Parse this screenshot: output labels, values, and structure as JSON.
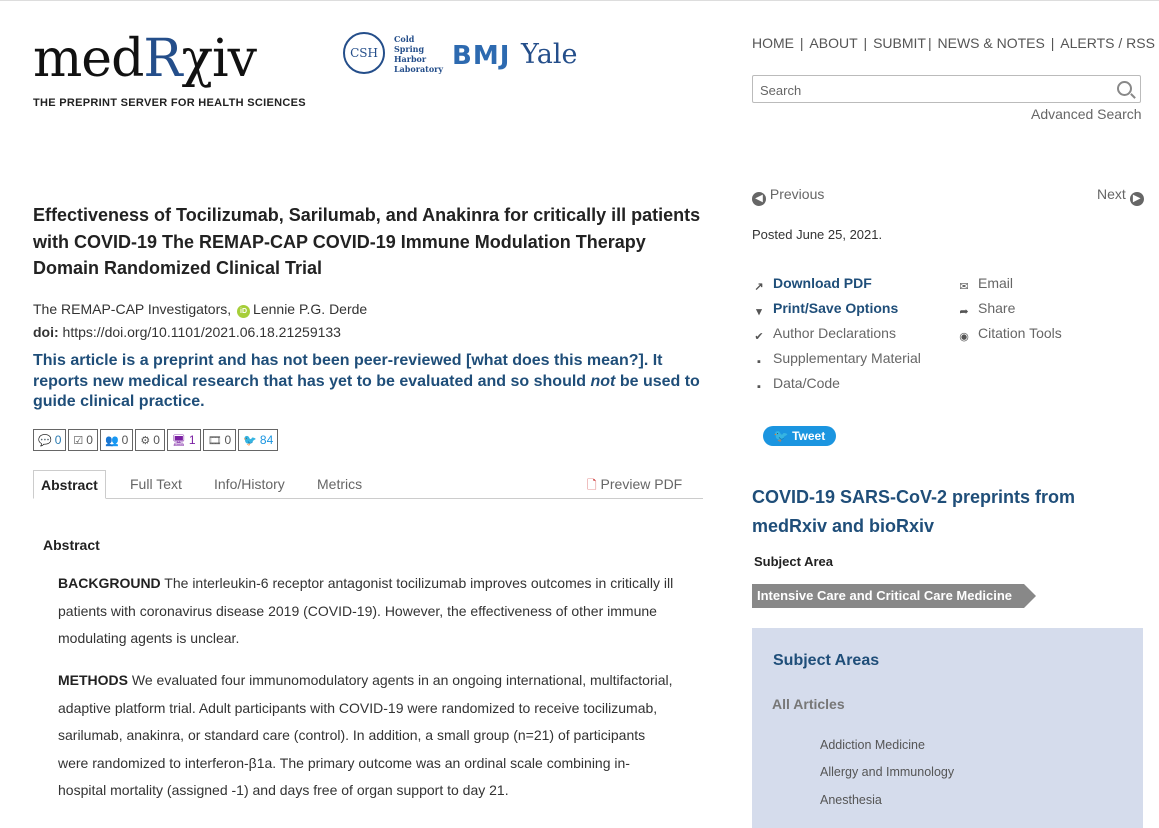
{
  "header": {
    "logo_prefix": "med",
    "logo_r": "R",
    "logo_suffix": "χiv",
    "tagline": "THE PREPRINT SERVER FOR HEALTH SCIENCES",
    "partner_csh_badge": "CSH",
    "partner_csh_text": [
      "Cold",
      "Spring",
      "Harbor",
      "Laboratory"
    ],
    "partner_bmj": "BMJ",
    "partner_yale": "Yale",
    "nav": [
      "HOME",
      "ABOUT",
      "SUBMIT",
      "NEWS & NOTES",
      "ALERTS / RSS"
    ],
    "search_placeholder": "Search",
    "advanced_search": "Advanced Search"
  },
  "article": {
    "title": "Effectiveness of Tocilizumab, Sarilumab, and Anakinra for critically ill patients with COVID-19 The REMAP-CAP COVID-19 Immune Modulation Therapy Domain Randomized Clinical Trial",
    "author_group": "The REMAP-CAP Investigators,",
    "orcid_badge": "iD",
    "author": "Lennie P.G. Derde",
    "doi_label": "doi:",
    "doi_value": "https://doi.org/10.1101/2021.06.18.21259133",
    "notice_part1": "This article is a preprint and has not been peer-reviewed [what does this mean?]. It reports new medical research that has yet to be evaluated and so should ",
    "notice_not": "not",
    "notice_part2": " be used to guide clinical practice.",
    "metrics": [
      {
        "icon": "comment-icon",
        "glyph": "💬",
        "count": "0",
        "color": "#2a7ab0"
      },
      {
        "icon": "review-icon",
        "glyph": "☑",
        "count": "0",
        "color": "#555"
      },
      {
        "icon": "community-icon",
        "glyph": "👥",
        "count": "0",
        "color": "#555"
      },
      {
        "icon": "connections-icon",
        "glyph": "⚙",
        "count": "0",
        "color": "#555"
      },
      {
        "icon": "monitor-icon",
        "glyph": "🖥",
        "count": "1",
        "color": "#7a1fa2"
      },
      {
        "icon": "video-icon",
        "glyph": "🎞",
        "count": "0",
        "color": "#555"
      },
      {
        "icon": "twitter-icon",
        "glyph": "🐦",
        "count": "84",
        "color": "#1b95e0"
      }
    ],
    "tabs": [
      "Abstract",
      "Full Text",
      "Info/History",
      "Metrics"
    ],
    "preview_pdf": "Preview PDF",
    "abstract_heading": "Abstract",
    "background_label": "BACKGROUND",
    "background_text": " The interleukin-6 receptor antagonist tocilizumab improves outcomes in critically ill patients with coronavirus disease 2019 (COVID-19). However, the effectiveness of other immune modulating agents is unclear.",
    "methods_label": "METHODS",
    "methods_text": " We evaluated four immunomodulatory agents in an ongoing international, multifactorial, adaptive platform trial. Adult participants with COVID-19 were randomized to receive tocilizumab, sarilumab, anakinra, or standard care (control). In addition, a small group (n=21) of participants were randomized to interferon-β1a. The primary outcome was an ordinal scale combining in-hospital mortality (assigned -1) and days free of organ support to day 21."
  },
  "sidebar": {
    "previous": "Previous",
    "next": "Next",
    "posted": "Posted June 25, 2021.",
    "tools_left": [
      {
        "label": "Download PDF",
        "icon": "external-link-icon",
        "glyph": "↗",
        "style": "tb"
      },
      {
        "label": "Print/Save Options",
        "icon": "dropdown-box-icon",
        "glyph": "▾",
        "style": "tb"
      },
      {
        "label": "Author Declarations",
        "icon": "checkbox-icon",
        "glyph": "✔",
        "style": "tg"
      },
      {
        "label": "Supplementary Material",
        "icon": "file-icon",
        "glyph": "▪",
        "style": "tg"
      },
      {
        "label": "Data/Code",
        "icon": "file-icon",
        "glyph": "▪",
        "style": "tg"
      }
    ],
    "tools_right": [
      {
        "label": "Email",
        "icon": "envelope-icon",
        "glyph": "✉"
      },
      {
        "label": "Share",
        "icon": "share-icon",
        "glyph": "➦"
      },
      {
        "label": "Citation Tools",
        "icon": "globe-icon",
        "glyph": "◉"
      }
    ],
    "tweet": "Tweet",
    "covid_link": "COVID-19 SARS-CoV-2 preprints from medRxiv and bioRxiv",
    "subject_area_label": "Subject Area",
    "subject_area_pill": "Intensive Care and Critical Care Medicine",
    "subject_areas_title": "Subject Areas",
    "all_articles": "All Articles",
    "subject_list": [
      "Addiction Medicine",
      "Allergy and Immunology",
      "Anesthesia"
    ]
  },
  "colors": {
    "brand_blue": "#1f4e79",
    "logo_blue": "#244e8a",
    "subject_box_bg": "#d5dcec"
  }
}
